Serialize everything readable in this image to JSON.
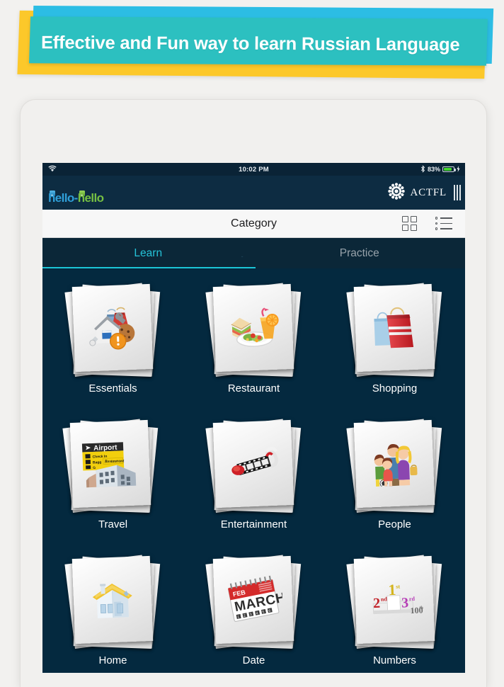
{
  "banner": {
    "headline": "Effective and Fun way to learn Russian Language",
    "colors": {
      "yellow": "#fcc82a",
      "cyan": "#2cbde4",
      "teal": "#2cc0c0",
      "text": "#ffffff"
    }
  },
  "device": {
    "type": "tablet",
    "camera_icon": "camera-dot"
  },
  "status_bar": {
    "wifi_icon": "wifi-icon",
    "time": "10:02 PM",
    "bluetooth_icon": "bluetooth-icon",
    "battery_percent": "83%",
    "battery_level": 83,
    "charging_icon": "lightning-bolt-icon",
    "background": "#0a2336"
  },
  "brand_bar": {
    "logo_part1": "hello",
    "logo_dash": "-",
    "logo_part2": "hello",
    "logo_color1": "#2f9fd8",
    "logo_color2": "#76c043",
    "partner_name": "ACTFL",
    "partner_icon": "starburst-icon",
    "menu_icon": "three-bars-icon"
  },
  "nav_bar": {
    "title": "Category",
    "grid_view_icon": "grid-view-icon",
    "list_view_icon": "list-view-icon"
  },
  "tabs": {
    "items": [
      {
        "label": "Learn",
        "active": true
      },
      {
        "label": "Practice",
        "active": false
      }
    ],
    "marker": "-",
    "active_color": "#25c3d8",
    "inactive_color": "#97a2aa"
  },
  "categories": [
    {
      "label": "Essentials",
      "icon": "essentials-icon"
    },
    {
      "label": "Restaurant",
      "icon": "restaurant-icon"
    },
    {
      "label": "Shopping",
      "icon": "shopping-bags-icon"
    },
    {
      "label": "Travel",
      "icon": "airport-icon"
    },
    {
      "label": "Entertainment",
      "icon": "film-strip-icon"
    },
    {
      "label": "People",
      "icon": "family-icon"
    },
    {
      "label": "Home",
      "icon": "house-icon"
    },
    {
      "label": "Date",
      "icon": "calendar-icon"
    },
    {
      "label": "Numbers",
      "icon": "podium-numbers-icon"
    }
  ],
  "artwork_text": {
    "travel_sign_title": "Airport",
    "travel_sign_rows": [
      "Check In",
      "Bagg",
      "G"
    ],
    "travel_sign_badge": "Restaurant",
    "date_month_small": "FEB",
    "date_month_large": "MARCH",
    "numbers": [
      "1st",
      "2nd",
      "3rd",
      "100th"
    ]
  },
  "screen_background": "#04293f"
}
